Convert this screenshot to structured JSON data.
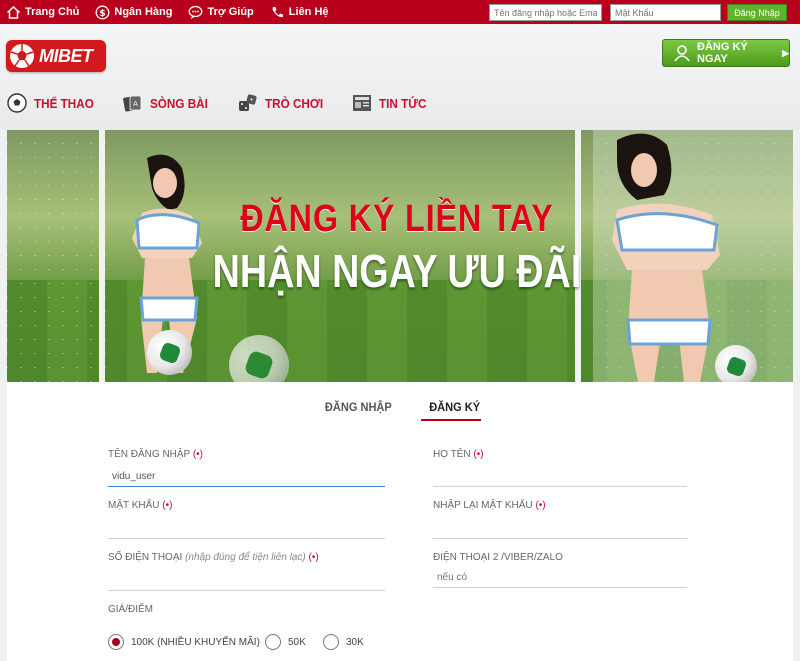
{
  "topnav": {
    "items": [
      {
        "label": "Trang Chủ",
        "icon": "home-icon"
      },
      {
        "label": "Ngân Hàng",
        "icon": "dollar-icon"
      },
      {
        "label": "Trợ Giúp",
        "icon": "chat-help-icon"
      },
      {
        "label": "Liên Hệ",
        "icon": "phone-icon"
      }
    ]
  },
  "login": {
    "username_placeholder": "Tên đăng nhập hoặc Email",
    "password_placeholder": "Mật Khẩu",
    "button_label": "Đăng Nhập"
  },
  "header": {
    "logo_text": "MIBET",
    "register_button": "ĐĂNG KÝ NGAY"
  },
  "mainnav": {
    "items": [
      {
        "label": "THỂ THAO",
        "icon": "soccer-ball-icon"
      },
      {
        "label": "SÒNG BÀI",
        "icon": "cards-icon"
      },
      {
        "label": "TRÒ CHƠI",
        "icon": "dice-icon"
      },
      {
        "label": "TIN TỨC",
        "icon": "newspaper-icon"
      }
    ]
  },
  "banner": {
    "line1": "ĐĂNG KÝ LIỀN TAY",
    "line2": "NHẬN NGAY ƯU ĐÃI"
  },
  "form": {
    "tabs": [
      {
        "label": "ĐĂNG NHẬP",
        "active": false
      },
      {
        "label": "ĐĂNG KÝ",
        "active": true
      }
    ],
    "required_mark": "(•)",
    "fields": {
      "username": {
        "label": "TÊN ĐĂNG NHẬP",
        "value": "vidu_user"
      },
      "fullname": {
        "label": "HỌ TÊN",
        "value": ""
      },
      "password": {
        "label": "MẬT KHẨU",
        "value": ""
      },
      "password_confirm": {
        "label": "NHẬP LẠI MẬT KHẨU",
        "value": ""
      },
      "phone": {
        "label": "SỐ ĐIỆN THOẠI",
        "hint": "(nhập đúng để tiện liên lạc)",
        "value": ""
      },
      "phone2": {
        "label": "ĐIỆN THOẠI 2 /VIBER/ZALO",
        "placeholder": "nếu có"
      }
    },
    "price_label": "GIÁ/ĐIỂM",
    "price_options": [
      {
        "label": "100K (NHIỀU KHUYẾN MÃI)",
        "selected": true
      },
      {
        "label": "50K",
        "selected": false
      },
      {
        "label": "30K",
        "selected": false
      }
    ]
  },
  "colors": {
    "brand_red": "#b8001c",
    "accent_green": "#5fb32e",
    "nav_red": "#c8102e"
  }
}
